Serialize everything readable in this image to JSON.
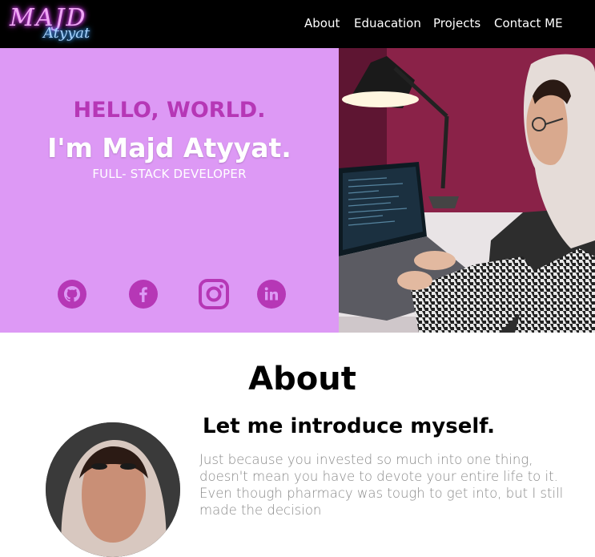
{
  "brand": {
    "line1": "MAJD",
    "line2": "Atyyat"
  },
  "nav": {
    "links": [
      {
        "label": "About"
      },
      {
        "label": "Eduacation"
      },
      {
        "label": "Projects"
      },
      {
        "label": "Contact ME"
      }
    ]
  },
  "hero": {
    "greeting": "HELLO, WORLD.",
    "name": "I'm Majd Atyyat.",
    "role": "FULL- STACK DEVELOPER",
    "social_icons": [
      "github-icon",
      "facebook-icon",
      "instagram-icon",
      "linkedin-icon"
    ]
  },
  "about": {
    "title": "About",
    "heading": "Let me introduce myself.",
    "bio": "Just because you invested so much into one thing, doesn't mean you have to devote your entire life to it. Even though pharmacy was tough to get into, but I still made the decision"
  },
  "colors": {
    "hero_bg": "#dd99f5",
    "accent": "#b637b6",
    "navbar_bg": "#000000"
  }
}
